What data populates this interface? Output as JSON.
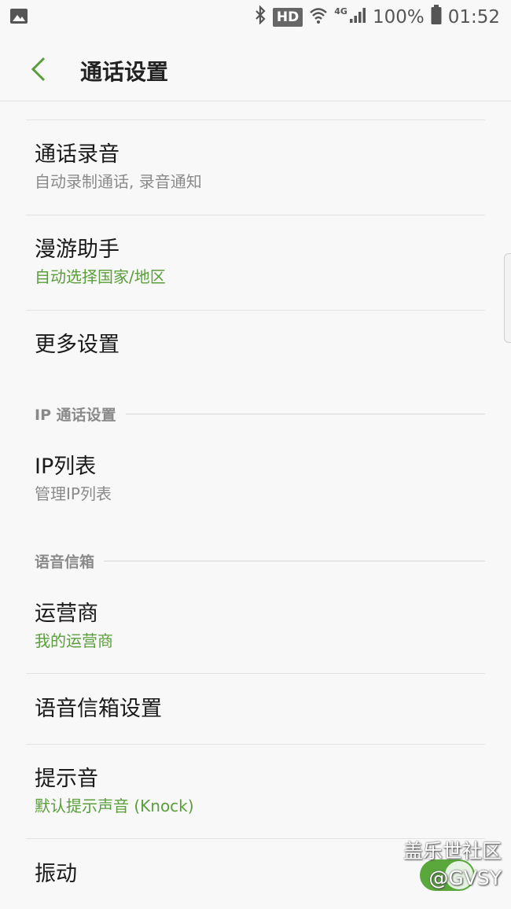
{
  "status_bar": {
    "left_icon": "gallery-icon",
    "hd_label": "HD",
    "network_label": "4G",
    "battery_percent": "100%",
    "time": "01:52",
    "icons": [
      "bluetooth-icon",
      "wifi-icon",
      "signal-icon",
      "battery-icon"
    ]
  },
  "header": {
    "title": "通话设置",
    "back_icon": "chevron-left-icon",
    "accent_color": "#5a9e3c"
  },
  "items": [
    {
      "title": "通话录音",
      "subtitle": "自动录制通话, 录音通知"
    },
    {
      "title": "漫游助手",
      "subtitle": "自动选择国家/地区"
    },
    {
      "title": "更多设置"
    }
  ],
  "section_ip": {
    "header": "IP 通话设置",
    "items": [
      {
        "title": "IP列表",
        "subtitle": "管理IP列表"
      }
    ]
  },
  "section_voicemail": {
    "header": "语音信箱",
    "items": [
      {
        "title": "运营商",
        "subtitle": "我的运营商"
      },
      {
        "title": "语音信箱设置"
      },
      {
        "title": "提示音",
        "subtitle": "默认提示声音 (Knock)"
      },
      {
        "title": "振动",
        "toggle_on": true
      }
    ]
  },
  "watermark": {
    "line1": "盖乐世社区",
    "line2": "@GVSY"
  }
}
